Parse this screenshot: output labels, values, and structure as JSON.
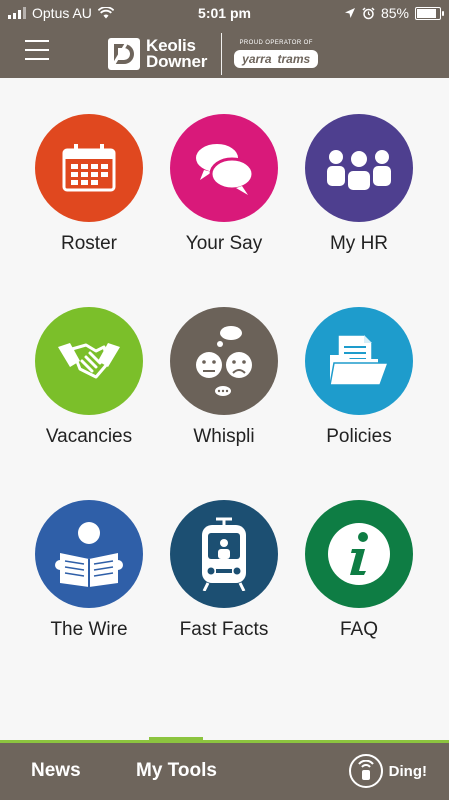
{
  "status_bar": {
    "carrier": "Optus AU",
    "time": "5:01 pm",
    "battery": "85%",
    "battery_level": 0.85,
    "wifi_icon": "wifi-icon",
    "location_icon": "location-arrow-icon",
    "alarm_icon": "alarm-clock-icon"
  },
  "header": {
    "brand_line1": "Keolis",
    "brand_line2": "Downer",
    "operator_label": "PROUD OPERATOR OF",
    "trams_word1": "yarra",
    "trams_word2": "trams",
    "menu_icon": "hamburger-menu-icon"
  },
  "tiles": [
    {
      "label": "Roster",
      "color": "#e0481f",
      "icon": "calendar-icon"
    },
    {
      "label": "Your Say",
      "color": "#d9197a",
      "icon": "chat-bubbles-icon"
    },
    {
      "label": "My HR",
      "color": "#4e3f8f",
      "icon": "people-group-icon"
    },
    {
      "label": "Vacancies",
      "color": "#7bbf2a",
      "icon": "handshake-icon"
    },
    {
      "label": "Whispli",
      "color": "#6b6259",
      "icon": "faces-thought-icon"
    },
    {
      "label": "Policies",
      "color": "#1e9ccc",
      "icon": "folder-documents-icon"
    },
    {
      "label": "The Wire",
      "color": "#2f5fa8",
      "icon": "reader-newspaper-icon"
    },
    {
      "label": "Fast Facts",
      "color": "#1c4f72",
      "icon": "tram-front-icon"
    },
    {
      "label": "FAQ",
      "color": "#0e7d44",
      "icon": "info-icon"
    }
  ],
  "bottom_nav": {
    "tabs": [
      {
        "label": "News"
      },
      {
        "label": "My Tools"
      }
    ],
    "active_tab": "My Tools",
    "ding_label": "Ding!",
    "accent": "#8cc43f"
  }
}
